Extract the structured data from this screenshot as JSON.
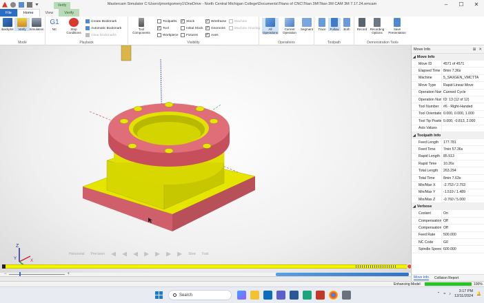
{
  "window": {
    "title": "Mastercam Simulator  C:\\Users\\jmontgomery1\\OneDrive - North Central Michigan College\\Documents\\Titans of CNC\\Titan 3M\\Titan 3M CAM 3M 7.17.24.emcam",
    "context_tab": "Verify"
  },
  "tabs": {
    "file": "File",
    "home": "Home",
    "view": "View",
    "verify": "Verify"
  },
  "ribbon": {
    "mode": {
      "label": "Mode",
      "backplot": "Backplot",
      "verify": "Verify",
      "simulation": "Simulation"
    },
    "playback": {
      "label": "Playback",
      "nc": "NC",
      "g1": "G1",
      "stop_conditions": "Stop Conditions",
      "create_bookmark": "Create Bookmark",
      "automatic_bookmark": "Automatic Bookmark",
      "clear_bookmarks": "Clear Bookmarks"
    },
    "visibility": {
      "label": "Visibility",
      "tool_components": "Tool Components",
      "toolpaths": "Toolpaths",
      "tool": "Tool",
      "workpiece": "Workpiece",
      "stock": "Stock",
      "initial_stock": "Initial Stock",
      "fixtures": "Fixtures",
      "wireframe": "Wireframe",
      "gnomons": "Gnomons",
      "axes": "Axes",
      "machine": "Machine",
      "machine_housing": "Machine Housing"
    },
    "operations": {
      "label": "Operations",
      "all_operations": "All Operations",
      "current_operation": "Current Operation",
      "segment": "Segment"
    },
    "toolpath": {
      "label": "Toolpath",
      "trace": "Trace",
      "follow": "Follow",
      "both": "Both"
    },
    "demo": {
      "label": "Demonstration Tools",
      "record": "Record",
      "recording_options": "Recording Options",
      "save_presentation": "Save Presentation"
    }
  },
  "playback_controls": {
    "min_label": "Horizontal",
    "prec_label": "Precision",
    "max_label": "Max",
    "slow_label": "Slow",
    "fast_label": "Fast"
  },
  "panel": {
    "title": "Move Info",
    "sections": [
      {
        "title": "Move Info",
        "rows": [
          {
            "k": "Move ID",
            "v": "4571 of 4571"
          },
          {
            "k": "Elapsed Time",
            "v": "8min 7.36s"
          },
          {
            "k": "Machine",
            "v": "5_SAXGEN_VMCTTA"
          },
          {
            "k": "Move Type",
            "v": "Rapid Linear Move"
          },
          {
            "k": "Operation Name",
            "v": "Canned Cycle"
          },
          {
            "k": "Operation Numb",
            "v": "ID: 13 (12 of 12)"
          },
          {
            "k": "Tool Number",
            "v": "#6 -  Right-Handed"
          },
          {
            "k": "Tool Orientation",
            "v": "0.000, 0.000, 1.000"
          },
          {
            "k": "Tool Tip Position",
            "v": "0.000, -0.813, 2.000"
          },
          {
            "k": "Axis Values",
            "v": ""
          }
        ]
      },
      {
        "title": "Toolpath Info",
        "rows": [
          {
            "k": "Feed Length",
            "v": "177.781"
          },
          {
            "k": "Feed Time",
            "v": "7min 57.36s"
          },
          {
            "k": "Rapid Length",
            "v": "85.513"
          },
          {
            "k": "Rapid Time",
            "v": "10.26s"
          },
          {
            "k": "Total Length",
            "v": "263.294"
          },
          {
            "k": "Total Time",
            "v": "8min 7.63s"
          },
          {
            "k": "Min/Max X",
            "v": "-2.753 / 2.753"
          },
          {
            "k": "Min/Max Y",
            "v": "-1.519 / 1.489"
          },
          {
            "k": "Min/Max Z",
            "v": "-0.760 / 5.000"
          }
        ]
      },
      {
        "title": "Verbose",
        "rows": [
          {
            "k": "Coolant",
            "v": "On"
          },
          {
            "k": "Compensation T",
            "v": "Off"
          },
          {
            "k": "Compensation D",
            "v": "Off"
          },
          {
            "k": "Feed Rate",
            "v": "500.000"
          },
          {
            "k": "NC Code",
            "v": "G0"
          },
          {
            "k": "Spindle Speed",
            "v": "600.000"
          }
        ]
      }
    ],
    "tabs": {
      "move_info": "Move Info",
      "collision_report": "Collision Report"
    }
  },
  "status": {
    "enhancing": "Enhancing Model",
    "progress_pct": 100,
    "progress_label": "100%"
  },
  "taskbar": {
    "search": "Search",
    "time": "3:17 PM",
    "date": "12/11/2024"
  },
  "colors": {
    "accent": "#2b6cc4",
    "stock_top": "#e5e500",
    "stock_side": "#cf5f6a",
    "progress": "#f4f400"
  }
}
